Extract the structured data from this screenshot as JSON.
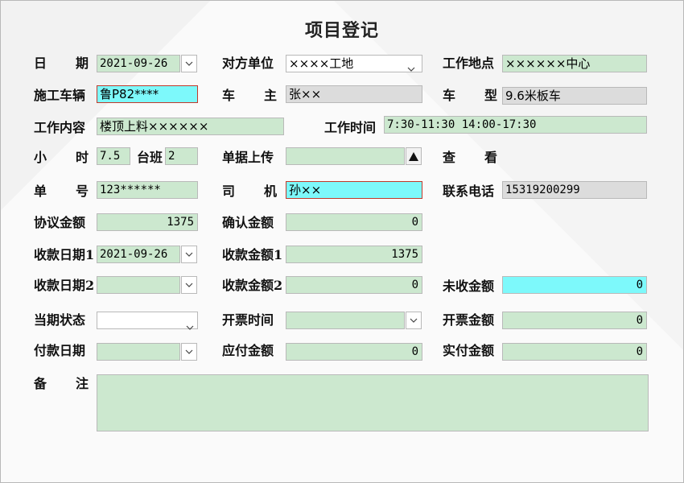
{
  "title": "项目登记",
  "labels": {
    "date": [
      "日",
      "期"
    ],
    "counterparty": "对方单位",
    "work_site": "工作地点",
    "vehicle": "施工车辆",
    "owner": [
      "车",
      "主"
    ],
    "vehicle_type": [
      "车",
      "型"
    ],
    "work_content": "工作内容",
    "work_time": "工作时间",
    "hours": [
      "小",
      "时"
    ],
    "shift": "台班",
    "receipt_upload": "单据上传",
    "view": [
      "查",
      "看"
    ],
    "order_no": [
      "单",
      "号"
    ],
    "driver": [
      "司",
      "机"
    ],
    "phone": "联系电话",
    "agreed_amount": "协议金额",
    "confirmed_amount": "确认金额",
    "pay_date_1": "收款日期1",
    "pay_amount_1": "收款金额1",
    "pay_date_2": "收款日期2",
    "pay_amount_2": "收款金额2",
    "unpaid_amount": "未收金额",
    "period_status": "当期状态",
    "invoice_time": "开票时间",
    "invoice_amount": "开票金额",
    "payment_date": "付款日期",
    "payable_amount": "应付金额",
    "paid_amount": "实付金额",
    "remarks": [
      "备",
      "注"
    ]
  },
  "values": {
    "date": "2021-09-26",
    "counterparty": "××××工地",
    "work_site": "××××××中心",
    "vehicle": "鲁P82****",
    "owner": "张××",
    "vehicle_type": "9.6米板车",
    "work_content": "楼顶上料××××××",
    "work_time": "7:30-11:30   14:00-17:30",
    "hours": "7.5",
    "shift": "2",
    "receipt_upload": "",
    "order_no": "123******",
    "driver": "孙××",
    "phone": "15319200299",
    "agreed_amount": "1375",
    "confirmed_amount": "0",
    "pay_date_1": "2021-09-26",
    "pay_amount_1": "1375",
    "pay_date_2": "",
    "pay_amount_2": "0",
    "unpaid_amount": "0",
    "period_status": "",
    "invoice_time": "",
    "invoice_amount": "0",
    "payment_date": "",
    "payable_amount": "0",
    "paid_amount": "0",
    "remarks": ""
  },
  "colors": {
    "field_green": "#cce8cf",
    "field_gray": "#dcdcdc",
    "field_cyan": "#7df9fb",
    "highlight_border": "#c0392b"
  }
}
